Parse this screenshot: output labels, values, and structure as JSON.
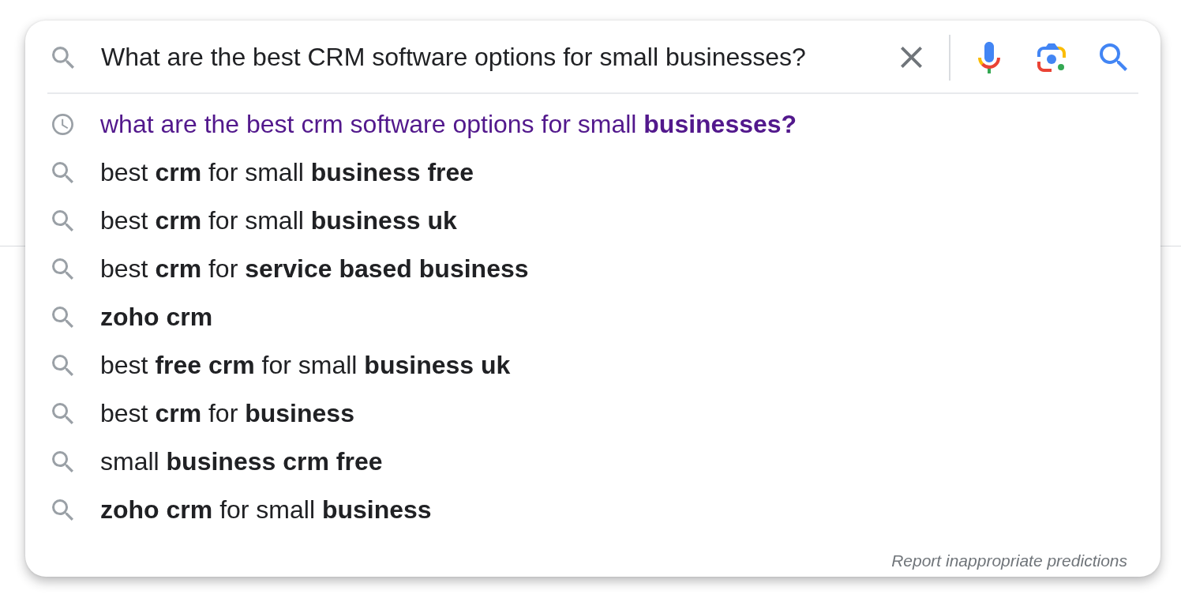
{
  "search_bar": {
    "value": "What are the best CRM software options for small businesses?"
  },
  "suggestions": [
    {
      "kind": "history",
      "text": "what are the best crm software options for small **businesses?**"
    },
    {
      "kind": "search",
      "text": "best **crm** for small **business free**"
    },
    {
      "kind": "search",
      "text": "best **crm** for small **business uk**"
    },
    {
      "kind": "search",
      "text": "best **crm** for **service based business**"
    },
    {
      "kind": "search",
      "text": "**zoho crm**"
    },
    {
      "kind": "search",
      "text": "best **free crm** for small **business uk**"
    },
    {
      "kind": "search",
      "text": "best **crm** for **business**"
    },
    {
      "kind": "search",
      "text": "small **business crm free**"
    },
    {
      "kind": "search",
      "text": "**zoho crm** for small **business**"
    }
  ],
  "footer": {
    "report_link": "Report inappropriate predictions"
  }
}
